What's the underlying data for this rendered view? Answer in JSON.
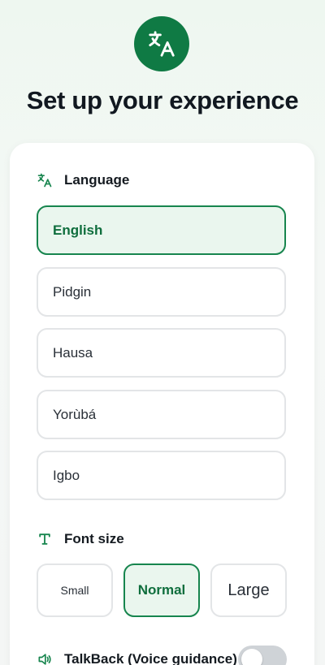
{
  "header": {
    "title": "Set up your experience",
    "icon": "translate-icon",
    "accent_color": "#0f7a44"
  },
  "language": {
    "heading": "Language",
    "icon": "translate-icon",
    "selected": "English",
    "options": [
      "English",
      "Pidgin",
      "Hausa",
      "Yorùbá",
      "Igbo"
    ]
  },
  "font_size": {
    "heading": "Font size",
    "icon": "text-size-icon",
    "selected": "Normal",
    "options": [
      "Small",
      "Normal",
      "Large"
    ]
  },
  "talkback": {
    "label": "TalkBack (Voice guidance)",
    "icon": "speaker-icon",
    "enabled": false
  }
}
